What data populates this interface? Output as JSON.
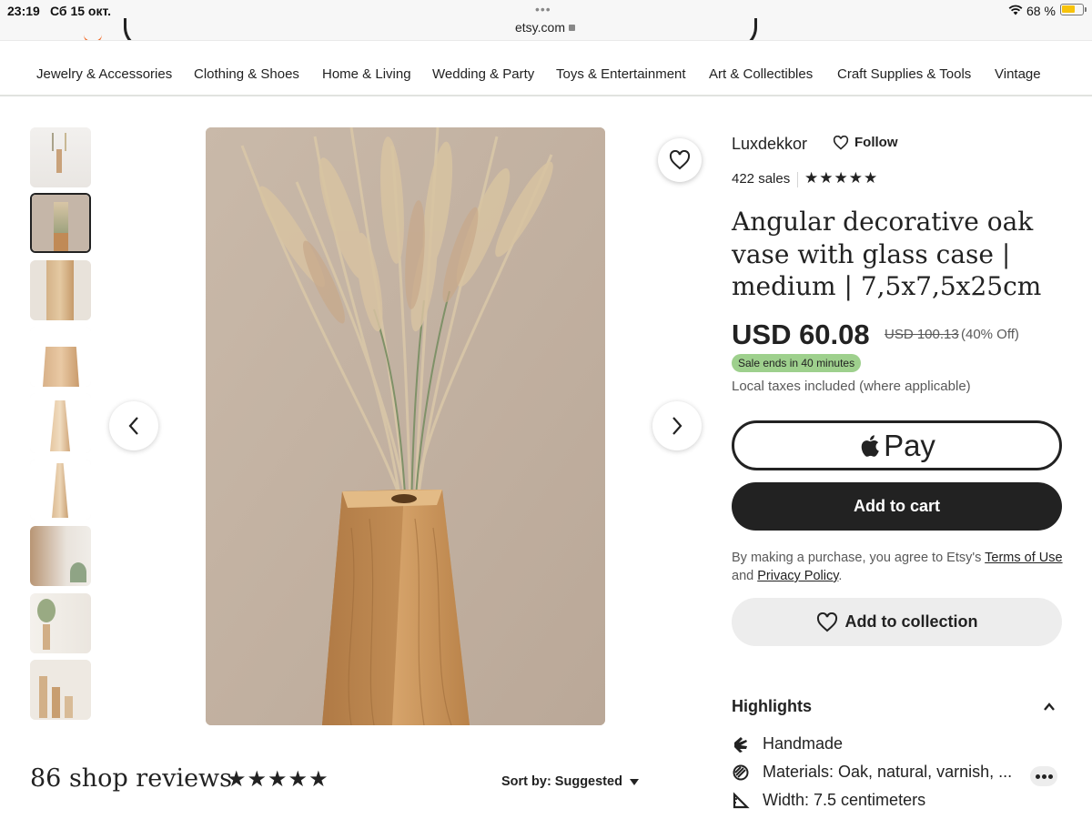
{
  "status_bar": {
    "time": "23:19",
    "date": "Сб 15 окт.",
    "url": "etsy.com",
    "battery_percent": "68 %",
    "battery_level": 0.68
  },
  "categories": [
    "Jewelry & Accessories",
    "Clothing & Shoes",
    "Home & Living",
    "Wedding & Party",
    "Toys & Entertainment",
    "Art & Collectibles",
    "Craft Supplies & Tools",
    "Vintage"
  ],
  "listing": {
    "shop_name": "Luxdekkor",
    "follow_label": "Follow",
    "sales": "422 sales",
    "stars": "★★★★★",
    "title": "Angular decorative oak vase with glass case | medium | 7,5x7,5x25cm",
    "price": "USD 60.08",
    "original_price": "USD 100.13",
    "discount": "(40% Off)",
    "sale_badge": "Sale ends in 40 minutes",
    "taxes_note": "Local taxes included (where applicable)",
    "apple_pay_label": "Pay",
    "add_to_cart_label": "Add to cart",
    "legal_prefix": "By making a purchase, you agree to Etsy's ",
    "terms_link": "Terms of Use",
    "legal_and": " and ",
    "privacy_link": "Privacy Policy",
    "legal_suffix": ".",
    "add_to_collection_label": "Add to collection"
  },
  "highlights": {
    "title": "Highlights",
    "items": [
      {
        "icon": "hand-icon",
        "text": "Handmade"
      },
      {
        "icon": "materials-icon",
        "text": "Materials: Oak, natural, varnish, ..."
      },
      {
        "icon": "ruler-icon",
        "text": "Width: 7.5 centimeters"
      }
    ]
  },
  "reviews": {
    "title": "86 shop reviews",
    "stars": "★★★★★",
    "sort_label": "Sort by: Suggested"
  },
  "colors": {
    "etsy_orange": "#f1641e",
    "sale_green": "#9ed08d",
    "primary_dark": "#222222",
    "battery_yellow": "#f7c30b"
  }
}
